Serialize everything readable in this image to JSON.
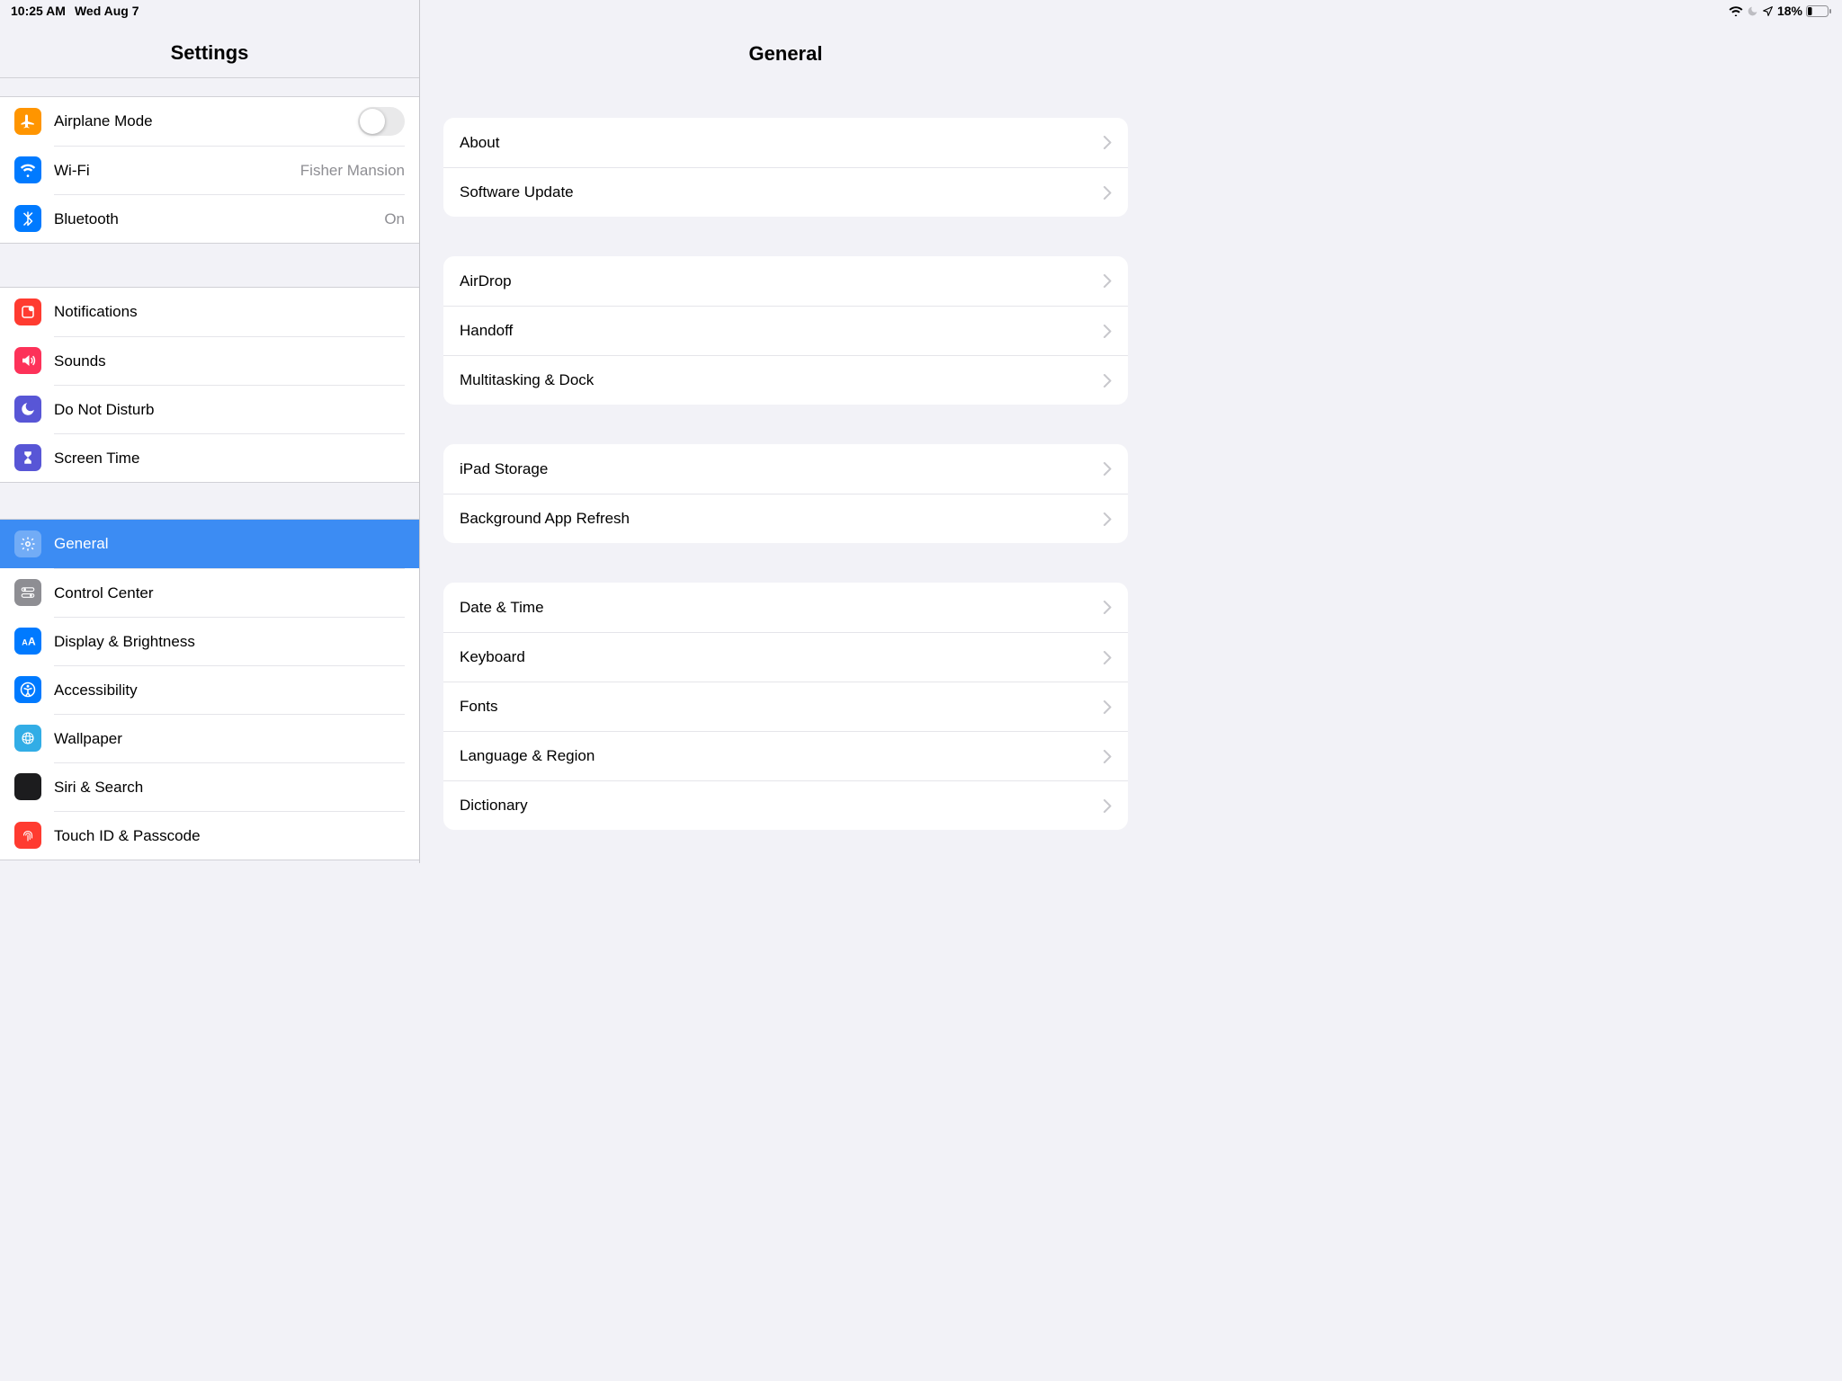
{
  "status": {
    "time": "10:25 AM",
    "date": "Wed Aug 7",
    "battery_pct": "18%"
  },
  "sidebar": {
    "title": "Settings",
    "groups": [
      {
        "items": [
          {
            "id": "airplane",
            "label": "Airplane Mode",
            "icon": "airplane-icon",
            "color": "c-orange",
            "toggle": false
          },
          {
            "id": "wifi",
            "label": "Wi-Fi",
            "icon": "wifi-icon",
            "color": "c-blue",
            "value": "Fisher Mansion"
          },
          {
            "id": "bluetooth",
            "label": "Bluetooth",
            "icon": "bluetooth-icon",
            "color": "c-blue",
            "value": "On"
          }
        ]
      },
      {
        "items": [
          {
            "id": "notifications",
            "label": "Notifications",
            "icon": "notifications-icon",
            "color": "c-red"
          },
          {
            "id": "sounds",
            "label": "Sounds",
            "icon": "sounds-icon",
            "color": "c-pink"
          },
          {
            "id": "dnd",
            "label": "Do Not Disturb",
            "icon": "moon-icon",
            "color": "c-indigo"
          },
          {
            "id": "screentime",
            "label": "Screen Time",
            "icon": "hourglass-icon",
            "color": "c-indigo"
          }
        ]
      },
      {
        "items": [
          {
            "id": "general",
            "label": "General",
            "icon": "gear-icon",
            "color": "c-gray",
            "selected": true
          },
          {
            "id": "controlcenter",
            "label": "Control Center",
            "icon": "switches-icon",
            "color": "c-gray2"
          },
          {
            "id": "display",
            "label": "Display & Brightness",
            "icon": "textsize-icon",
            "color": "c-blue"
          },
          {
            "id": "accessibility",
            "label": "Accessibility",
            "icon": "accessibility-icon",
            "color": "c-blue"
          },
          {
            "id": "wallpaper",
            "label": "Wallpaper",
            "icon": "wallpaper-icon",
            "color": "c-teal"
          },
          {
            "id": "siri",
            "label": "Siri & Search",
            "icon": "siri-icon",
            "color": "c-black"
          },
          {
            "id": "touchid",
            "label": "Touch ID & Passcode",
            "icon": "fingerprint-icon",
            "color": "c-red"
          }
        ]
      }
    ]
  },
  "detail": {
    "title": "General",
    "groups": [
      {
        "items": [
          {
            "id": "about",
            "label": "About"
          },
          {
            "id": "software",
            "label": "Software Update"
          }
        ]
      },
      {
        "items": [
          {
            "id": "airdrop",
            "label": "AirDrop"
          },
          {
            "id": "handoff",
            "label": "Handoff"
          },
          {
            "id": "multitasking",
            "label": "Multitasking & Dock"
          }
        ]
      },
      {
        "items": [
          {
            "id": "storage",
            "label": "iPad Storage"
          },
          {
            "id": "bgrefresh",
            "label": "Background App Refresh"
          }
        ]
      },
      {
        "items": [
          {
            "id": "datetime",
            "label": "Date & Time"
          },
          {
            "id": "keyboard",
            "label": "Keyboard"
          },
          {
            "id": "fonts",
            "label": "Fonts"
          },
          {
            "id": "language",
            "label": "Language & Region"
          },
          {
            "id": "dictionary",
            "label": "Dictionary"
          }
        ]
      }
    ]
  }
}
